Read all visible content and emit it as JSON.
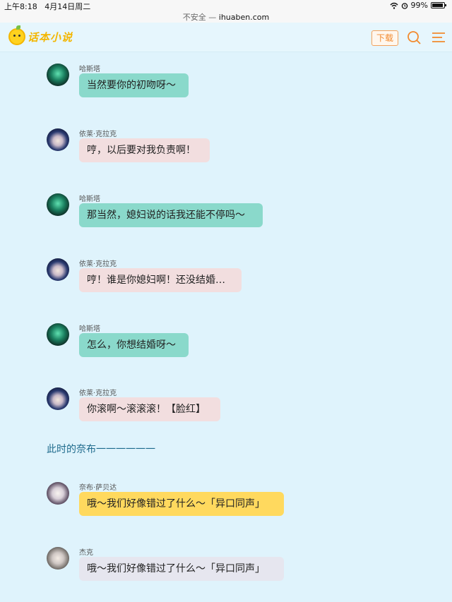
{
  "status_bar": {
    "time": "上午8:18",
    "date": "4月14日周二",
    "battery": "99%"
  },
  "url_bar": {
    "security": "不安全 — ",
    "domain": "ihuaben.com"
  },
  "header": {
    "logo_text": "话本小说",
    "download_label": "下载"
  },
  "messages": [
    {
      "speaker": "哈斯塔",
      "text": "当然要你的初吻呀～",
      "style": "teal",
      "avatar": "green"
    },
    {
      "speaker": "依莱·克拉克",
      "text": "哼，以后要对我负责啊！",
      "style": "pink",
      "avatar": "navy"
    },
    {
      "speaker": "哈斯塔",
      "text": "那当然，媳妇说的话我还能不停吗～",
      "style": "teal",
      "avatar": "green"
    },
    {
      "speaker": "依莱·克拉克",
      "text": "哼！谁是你媳妇啊！还没结婚…",
      "style": "pink",
      "avatar": "navy"
    },
    {
      "speaker": "哈斯塔",
      "text": "怎么，你想结婚呀～",
      "style": "teal",
      "avatar": "green"
    },
    {
      "speaker": "依莱·克拉克",
      "text": "你滚啊～滚滚滚！【脸红】",
      "style": "pink",
      "avatar": "navy"
    },
    {
      "speaker": "奈布·萨贝达",
      "text": "哦～我们好像错过了什么～「异口同声」",
      "style": "yellow",
      "avatar": "naib"
    },
    {
      "speaker": "杰克",
      "text": "哦～我们好像错过了什么～「异口同声」",
      "style": "grey",
      "avatar": "jack"
    }
  ],
  "narration": "此时的奈布一一一一一一",
  "colors": {
    "background": "#dff3fc",
    "teal_bubble": "#8ad9cb",
    "pink_bubble": "#f2dedf",
    "yellow_bubble": "#ffd95e",
    "grey_bubble": "#e6e6ef",
    "accent_orange": "#f28a2e"
  }
}
